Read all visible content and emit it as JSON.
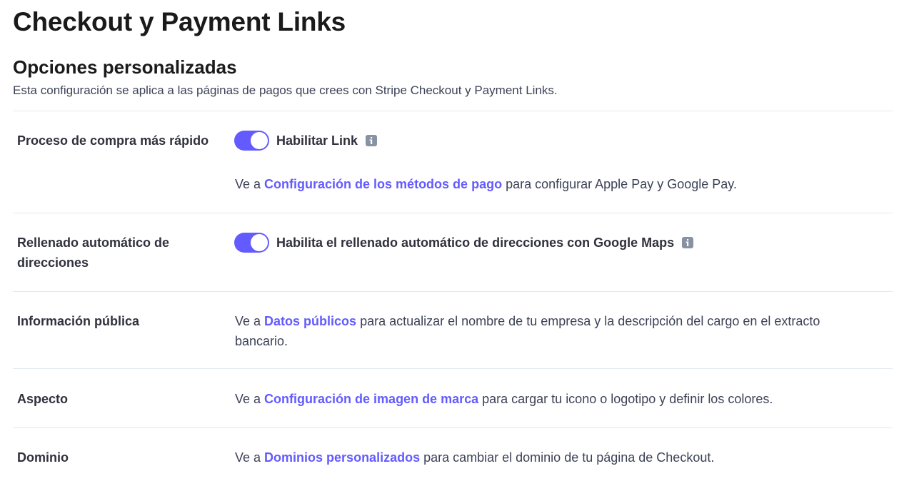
{
  "page": {
    "title": "Checkout y Payment Links"
  },
  "section": {
    "title": "Opciones personalizadas",
    "description": "Esta configuración se aplica a las páginas de pagos que crees con Stripe Checkout y Payment Links."
  },
  "rows": {
    "fast_checkout": {
      "label": "Proceso de compra más rápido",
      "toggle_label": "Habilitar Link",
      "toggle_on": true,
      "note_prefix": "Ve a ",
      "note_link": "Configuración de los métodos de pago",
      "note_suffix": " para configurar Apple Pay y Google Pay."
    },
    "address_autofill": {
      "label": "Rellenado automático de direcciones",
      "toggle_label": "Habilita el rellenado automático de direcciones con Google Maps",
      "toggle_on": true
    },
    "public_info": {
      "label": "Información pública",
      "prefix": "Ve a ",
      "link": "Datos públicos",
      "suffix": " para actualizar el nombre de tu empresa y la descripción del cargo en el extracto bancario."
    },
    "appearance": {
      "label": "Aspecto",
      "prefix": "Ve a ",
      "link": "Configuración de imagen de marca",
      "suffix": " para cargar tu icono o logotipo y definir los colores."
    },
    "domain": {
      "label": "Dominio",
      "prefix": "Ve a ",
      "link": "Dominios personalizados",
      "suffix": " para cambiar el dominio de tu página de Checkout."
    }
  },
  "icons": {
    "info": "info-icon"
  },
  "colors": {
    "accent": "#635bff",
    "toggle_on": "#635bff",
    "icon_gray": "#8792a2",
    "divider": "#e3e8ee"
  }
}
